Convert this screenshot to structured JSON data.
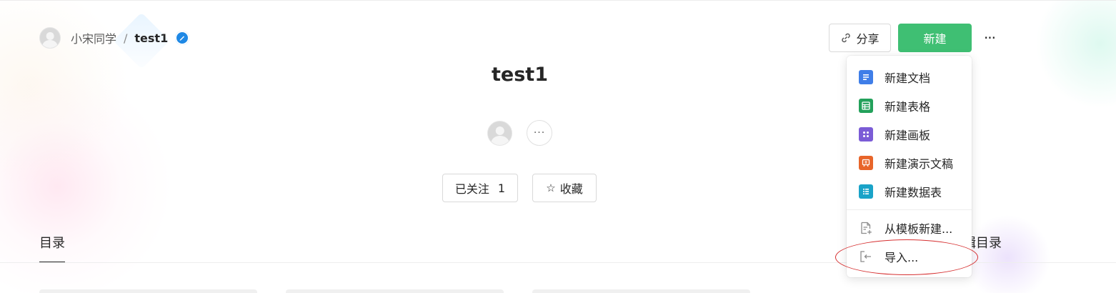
{
  "breadcrumb": {
    "user": "小宋同学",
    "separator": "/",
    "book": "test1"
  },
  "header": {
    "share_label": "分享",
    "new_label": "新建",
    "more_label": "···"
  },
  "book": {
    "title": "test1",
    "more_members_label": "···",
    "follow_label": "已关注",
    "follow_count": "1",
    "star_label": "收藏",
    "star_glyph": "☆"
  },
  "tabs": {
    "toc_label": "目录",
    "edit_toc_label": "编辑目录"
  },
  "dropdown": {
    "items": [
      {
        "label": "新建文档",
        "icon": "doc-icon",
        "color": "#3f7ee8"
      },
      {
        "label": "新建表格",
        "icon": "sheet-icon",
        "color": "#23a15b"
      },
      {
        "label": "新建画板",
        "icon": "board-icon",
        "color": "#7b5cd6"
      },
      {
        "label": "新建演示文稿",
        "icon": "slides-icon",
        "color": "#e8652a"
      },
      {
        "label": "新建数据表",
        "icon": "datatable-icon",
        "color": "#1aa3c8"
      }
    ],
    "template_label": "从模板新建...",
    "import_label": "导入..."
  },
  "colors": {
    "primary_green": "#3fbf73",
    "verified_blue": "#1e88e5",
    "annotation_red": "#d63031"
  }
}
